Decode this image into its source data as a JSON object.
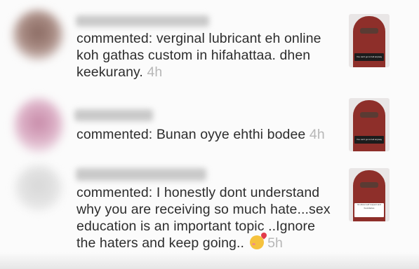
{
  "comments": [
    {
      "text": "commented: verginal lubricant eh online koh gathas custom in hifahattaa. dhen keekurany.",
      "time": "4h",
      "thumb_caption": "You can't go to hell anyway"
    },
    {
      "text": "commented: Bunan oyye ehthi bodee",
      "time": "4h",
      "thumb_caption": "You can't go to hell anyway"
    },
    {
      "text": "commented: I honestly dont understand why you are receiving so much hate...sex education is an important topic ..Ignore the haters and keep going..",
      "time": "5h",
      "emoji": "smiling-face-with-hearts",
      "thumb_caption": "Its about self respect and boundaries"
    }
  ]
}
